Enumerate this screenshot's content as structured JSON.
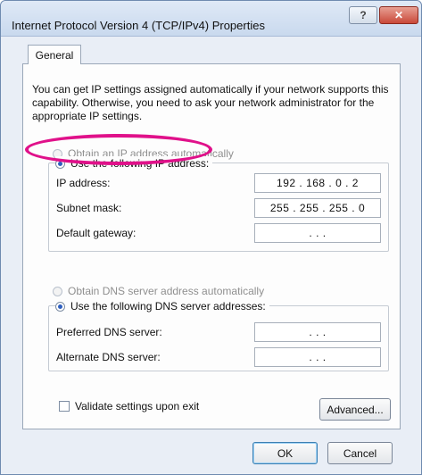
{
  "window": {
    "title": "Internet Protocol Version 4 (TCP/IPv4) Properties",
    "help_glyph": "?",
    "close_glyph": "✕"
  },
  "tabs": [
    {
      "label": "General"
    }
  ],
  "intro_text": "You can get IP settings assigned automatically if your network supports this capability. Otherwise, you need to ask your network administrator for the appropriate IP settings.",
  "ip_options": {
    "auto_label": "Obtain an IP address automatically",
    "manual_label": "Use the following IP address:",
    "selected": "manual"
  },
  "ip_fields": [
    {
      "label": "IP address:",
      "value": "192 . 168 .  0  .  2"
    },
    {
      "label": "Subnet mask:",
      "value": "255 . 255 . 255 .  0"
    },
    {
      "label": "Default gateway:",
      "value": ".        .        ."
    }
  ],
  "dns_options": {
    "auto_label": "Obtain DNS server address automatically",
    "manual_label": "Use the following DNS server addresses:",
    "selected": "manual"
  },
  "dns_fields": [
    {
      "label": "Preferred DNS server:",
      "value": ".        .        ."
    },
    {
      "label": "Alternate DNS server:",
      "value": ".        .        ."
    }
  ],
  "validate_label": "Validate settings upon exit",
  "validate_checked": false,
  "buttons": {
    "advanced": "Advanced...",
    "ok": "OK",
    "cancel": "Cancel"
  },
  "colors": {
    "highlight": "#e0118a",
    "radio_selected": "#2f5fbf"
  }
}
